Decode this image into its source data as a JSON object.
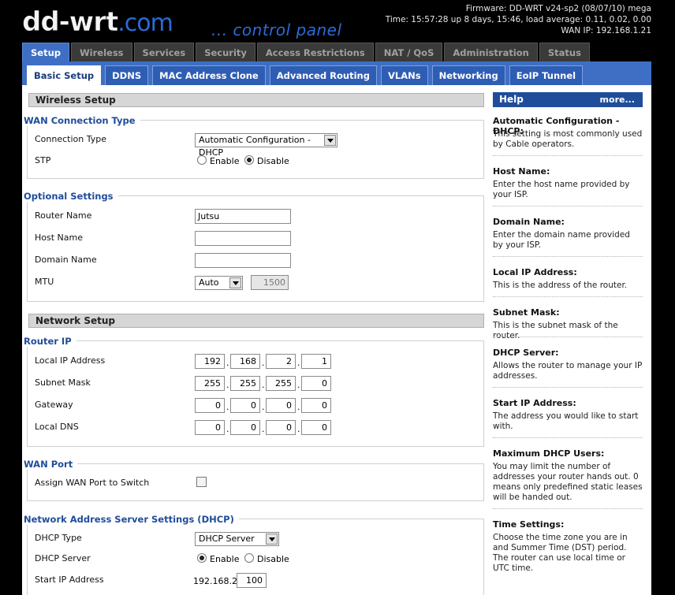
{
  "header": {
    "logo_main": "dd-wrt",
    "logo_suffix": ".com",
    "subtitle": "... control panel",
    "firmware": "Firmware: DD-WRT v24-sp2 (08/07/10) mega",
    "time": "Time: 15:57:28 up 8 days, 15:46, load average: 0.11, 0.02, 0.00",
    "wan_ip": "WAN IP: 192.168.1.21"
  },
  "main_tabs": [
    "Setup",
    "Wireless",
    "Services",
    "Security",
    "Access Restrictions",
    "NAT / QoS",
    "Administration",
    "Status"
  ],
  "sub_tabs": [
    "Basic Setup",
    "DDNS",
    "MAC Address Clone",
    "Advanced Routing",
    "VLANs",
    "Networking",
    "EoIP Tunnel"
  ],
  "wireless_setup": {
    "title": "Wireless Setup",
    "wan_conn": {
      "legend": "WAN Connection Type",
      "conn_type_label": "Connection Type",
      "conn_type_value": "Automatic Configuration - DHCP",
      "stp_label": "STP",
      "stp_enable": "Enable",
      "stp_disable": "Disable"
    },
    "optional": {
      "legend": "Optional Settings",
      "router_name_label": "Router Name",
      "router_name_value": "Jutsu",
      "host_name_label": "Host Name",
      "host_name_value": "",
      "domain_name_label": "Domain Name",
      "domain_name_value": "",
      "mtu_label": "MTU",
      "mtu_mode": "Auto",
      "mtu_value": "1500"
    }
  },
  "network_setup": {
    "title": "Network Setup",
    "router_ip": {
      "legend": "Router IP",
      "local_ip_label": "Local IP Address",
      "local_ip": [
        "192",
        "168",
        "2",
        "1"
      ],
      "subnet_label": "Subnet Mask",
      "subnet": [
        "255",
        "255",
        "255",
        "0"
      ],
      "gateway_label": "Gateway",
      "gateway": [
        "0",
        "0",
        "0",
        "0"
      ],
      "dns_label": "Local DNS",
      "dns": [
        "0",
        "0",
        "0",
        "0"
      ]
    },
    "wan_port": {
      "legend": "WAN Port",
      "assign_label": "Assign WAN Port to Switch"
    },
    "dhcp": {
      "legend": "Network Address Server Settings (DHCP)",
      "type_label": "DHCP Type",
      "type_value": "DHCP Server",
      "server_label": "DHCP Server",
      "enable": "Enable",
      "disable": "Disable",
      "start_label": "Start IP Address",
      "start_prefix": "192.168.2.",
      "start_value": "100"
    }
  },
  "help": {
    "title": "Help",
    "more": "more...",
    "items": [
      {
        "title": "Automatic Configuration - DHCP:",
        "text": "This setting is most commonly used by Cable operators."
      },
      {
        "title": "Host Name:",
        "text": "Enter the host name provided by your ISP."
      },
      {
        "title": "Domain Name:",
        "text": "Enter the domain name provided by your ISP."
      },
      {
        "title": "Local IP Address:",
        "text": "This is the address of the router."
      },
      {
        "title": "Subnet Mask:",
        "text": "This is the subnet mask of the router."
      },
      {
        "title": "DHCP Server:",
        "text": "Allows the router to manage your IP addresses."
      },
      {
        "title": "Start IP Address:",
        "text": "The address you would like to start with."
      },
      {
        "title": "Maximum DHCP Users:",
        "text": "You may limit the number of addresses your router hands out. 0 means only predefined static leases will be handed out."
      },
      {
        "title": "Time Settings:",
        "text": "Choose the time zone you are in and Summer Time (DST) period. The router can use local time or UTC time."
      }
    ]
  }
}
